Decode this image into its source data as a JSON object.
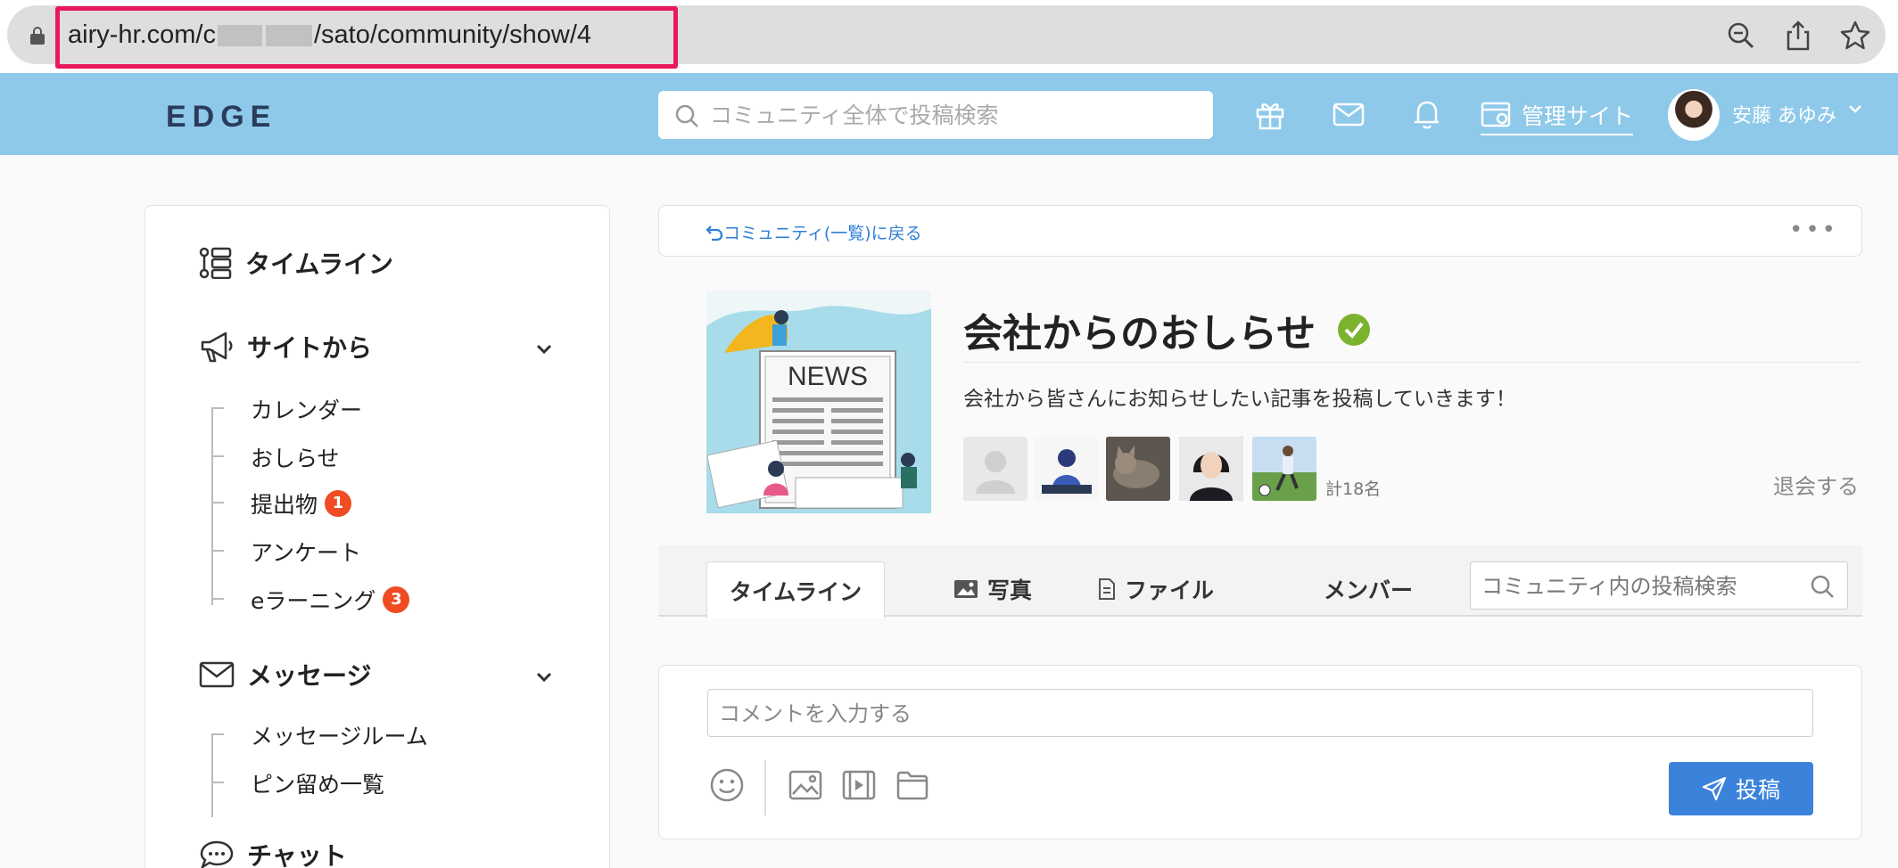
{
  "browser": {
    "url_prefix": "airy-hr.com/c",
    "url_suffix": "/sato/community/show/4",
    "icons": [
      "zoom-icon",
      "share-icon",
      "star-icon"
    ]
  },
  "header": {
    "logo": "EDGE",
    "search_placeholder": "コミュニティ全体で投稿検索",
    "admin_label": "管理サイト",
    "user_name": "安藤 あゆみ"
  },
  "sidebar": {
    "timeline": "タイムライン",
    "site_section": "サイトから",
    "site_items": [
      {
        "label": "カレンダー",
        "badge": ""
      },
      {
        "label": "おしらせ",
        "badge": ""
      },
      {
        "label": "提出物",
        "badge": "1"
      },
      {
        "label": "アンケート",
        "badge": ""
      },
      {
        "label": "eラーニング",
        "badge": "3"
      }
    ],
    "message_section": "メッセージ",
    "message_items": [
      {
        "label": "メッセージルーム"
      },
      {
        "label": "ピン留め一覧"
      }
    ],
    "chat_section": "チャット"
  },
  "community": {
    "back_label": "コミュニティ(一覧)に戻る",
    "banner_text": "NEWS",
    "title": "会社からのおしらせ",
    "description": "会社から皆さんにお知らせしたい記事を投稿していきます！",
    "member_count": "計18名",
    "leave_label": "退会する"
  },
  "tabs": [
    {
      "label": "タイムライン",
      "active": true
    },
    {
      "label": "写真",
      "active": false
    },
    {
      "label": "ファイル",
      "active": false
    },
    {
      "label": "メンバー",
      "active": false
    }
  ],
  "tab_search_placeholder": "コミュニティ内の投稿検索",
  "composer": {
    "placeholder": "コメントを入力する",
    "post_label": "投稿"
  },
  "colors": {
    "header_bg": "#8ec9ea",
    "accent": "#3b82db",
    "badge": "#f04b22",
    "verified": "#7bb32e",
    "url_highlight": "#e8195a"
  }
}
